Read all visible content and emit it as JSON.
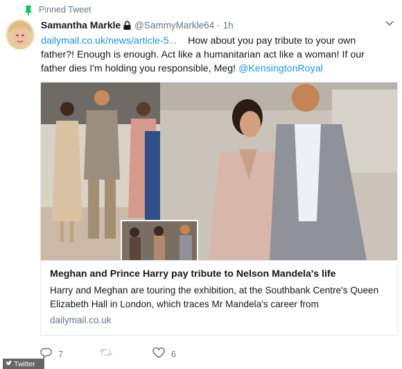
{
  "pinned": {
    "label": "Pinned Tweet"
  },
  "tweet": {
    "display_name": "Samantha Markle",
    "handle": "@SammyMarkle64",
    "separator": "·",
    "time": "1h",
    "link_text": "dailymail.co.uk/news/article-5...",
    "text_main": "How about you pay tribute to your own father?! Enough is enough. Act like a humanitarian act like a woman! If our father dies I'm holding you responsible, Meg!",
    "mention": "@KensingtonRoyal"
  },
  "card": {
    "title": "Meghan and Prince Harry pay tribute to Nelson Mandela's life",
    "description": "Harry and Meghan are touring the exhibition, at the Southbank Centre's Queen Elizabeth Hall in London, which traces Mr Mandela's career from",
    "domain": "dailymail.co.uk"
  },
  "actions": {
    "replies": "7",
    "retweets": "",
    "likes": "6"
  },
  "watermark": {
    "text": "Twitter"
  },
  "colors": {
    "link": "#1b95e0",
    "muted": "#657786",
    "border": "#e1e8ed",
    "pin": "#17bf63"
  },
  "icons": [
    "pin-icon",
    "lock-icon",
    "chevron-down-icon",
    "reply-icon",
    "retweet-icon",
    "heart-icon",
    "twitter-bird-icon"
  ]
}
